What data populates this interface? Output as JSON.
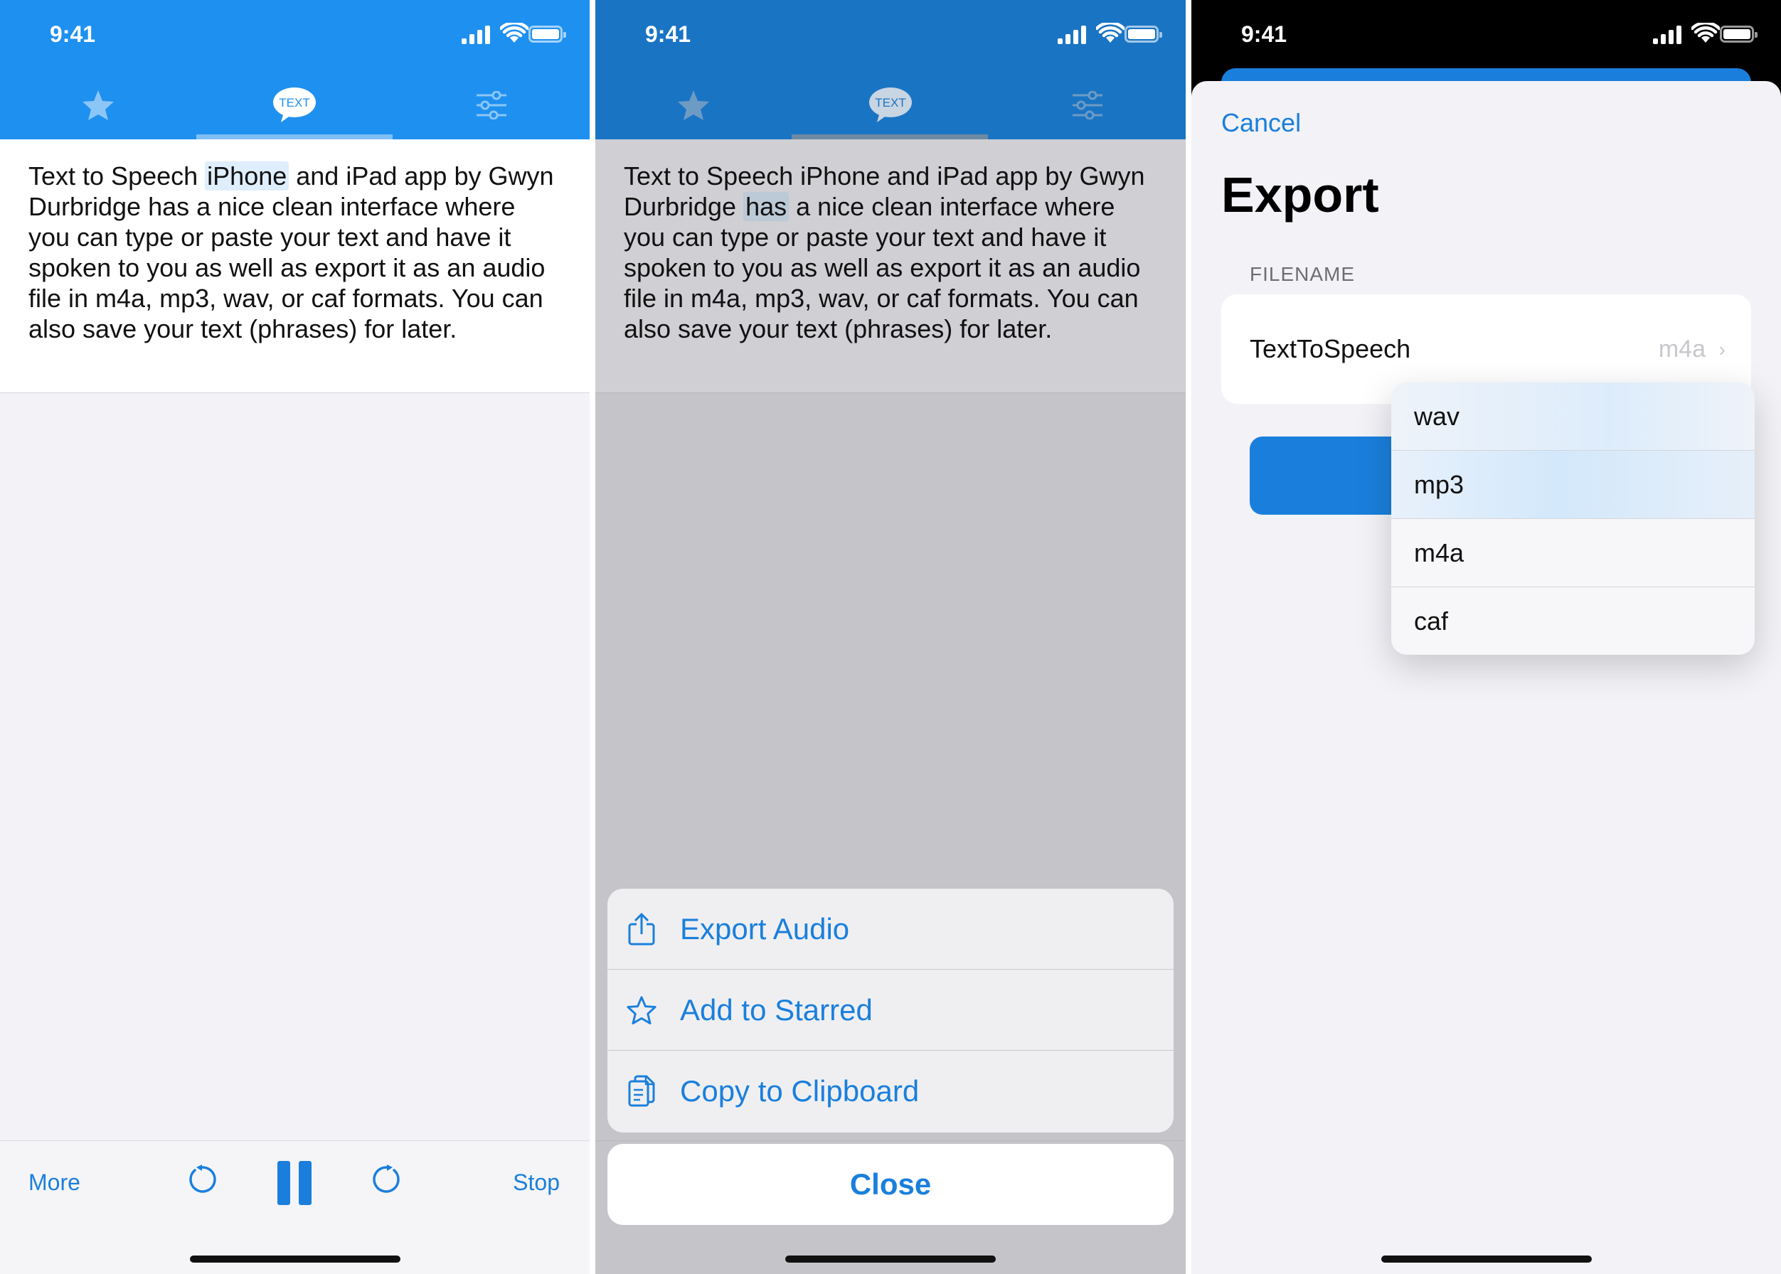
{
  "status": {
    "time": "9:41"
  },
  "tabs": [
    {
      "icon": "star-icon"
    },
    {
      "icon": "speech-bubble-icon",
      "label": "TEXT"
    },
    {
      "icon": "sliders-icon"
    }
  ],
  "phone1": {
    "text_before": "Text to Speech ",
    "text_highlight": "iPhone",
    "text_after": " and iPad app by Gwyn Durbridge has a nice clean interface where you can type or paste your text and have it spoken to you as well as export it as an audio file in m4a, mp3, wav, or caf formats. You can also save your text (phrases) for later.",
    "toolbar": {
      "more_label": "More",
      "stop_label": "Stop"
    }
  },
  "phone2": {
    "text_before": "Text to Speech iPhone and iPad app by Gwyn Durbridge ",
    "text_highlight": "has",
    "text_after": " a nice clean interface where you can type or paste your text and have it spoken to you as well as export it as an audio file in m4a, mp3, wav, or caf formats. You can also save your text (phrases) for later.",
    "actions": [
      {
        "icon": "share-icon",
        "label": "Export Audio"
      },
      {
        "icon": "star-outline-icon",
        "label": "Add to Starred"
      },
      {
        "icon": "clipboard-icon",
        "label": "Copy to Clipboard"
      }
    ],
    "close_label": "Close"
  },
  "phone3": {
    "cancel_label": "Cancel",
    "title": "Export",
    "section_label": "FILENAME",
    "filename": "TextToSpeech",
    "selected_format": "m4a",
    "formats": [
      "wav",
      "mp3",
      "m4a",
      "caf"
    ]
  },
  "colors": {
    "accent": "#1a7fdc",
    "header": "#1e90f0"
  }
}
